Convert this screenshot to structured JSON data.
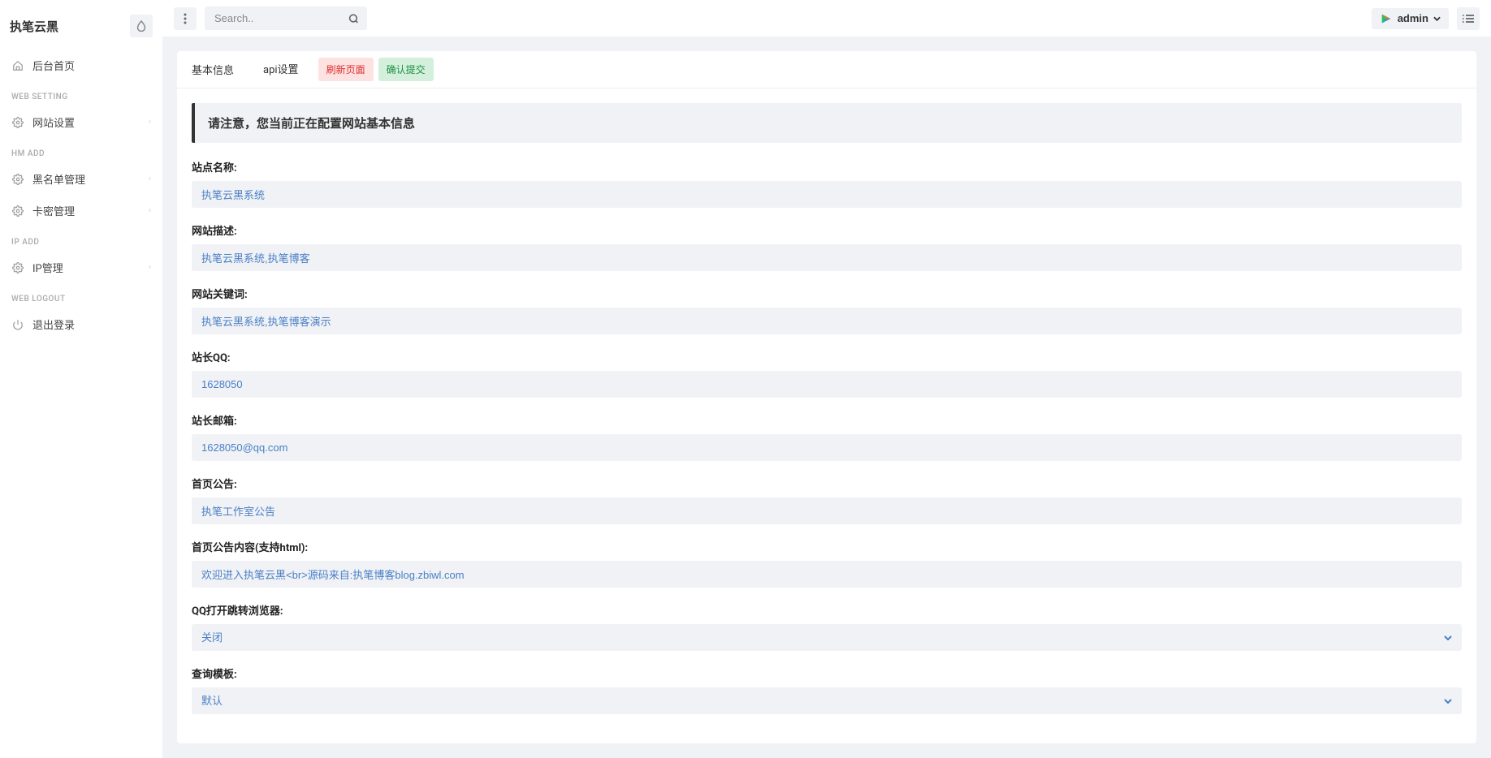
{
  "app": {
    "title": "执笔云黑"
  },
  "search": {
    "placeholder": "Search.."
  },
  "user": {
    "name": "admin"
  },
  "sidebar": {
    "home": {
      "label": "后台首页"
    },
    "sections": [
      {
        "header": "WEB SETTING",
        "items": [
          {
            "label": "网站设置",
            "icon": "gear",
            "expandable": true
          }
        ]
      },
      {
        "header": "HM ADD",
        "items": [
          {
            "label": "黑名单管理",
            "icon": "gear",
            "expandable": true
          },
          {
            "label": "卡密管理",
            "icon": "gear",
            "expandable": true
          }
        ]
      },
      {
        "header": "IP ADD",
        "items": [
          {
            "label": "IP管理",
            "icon": "gear",
            "expandable": true
          }
        ]
      },
      {
        "header": "WEB LOGOUT",
        "items": [
          {
            "label": "退出登录",
            "icon": "power",
            "expandable": false
          }
        ]
      }
    ]
  },
  "tabs": {
    "items": [
      {
        "label": "基本信息",
        "active": true
      },
      {
        "label": "api设置",
        "active": false
      }
    ],
    "refresh": "刷新页面",
    "submit": "确认提交"
  },
  "alert": "请注意，您当前正在配置网站基本信息",
  "form": {
    "site_name": {
      "label": "站点名称:",
      "value": "执笔云黑系统"
    },
    "site_desc": {
      "label": "网站描述:",
      "value": "执笔云黑系统,执笔博客"
    },
    "site_keywords": {
      "label": "网站关键词:",
      "value": "执笔云黑系统,执笔博客演示"
    },
    "admin_qq": {
      "label": "站长QQ:",
      "value": "1628050"
    },
    "admin_email": {
      "label": "站长邮箱:",
      "value": "1628050@qq.com"
    },
    "home_notice": {
      "label": "首页公告:",
      "value": "执笔工作室公告"
    },
    "home_notice_content": {
      "label": "首页公告内容(支持html):",
      "value": "欢迎进入执笔云黑<br>源码来自:执笔博客blog.zbiwl.com"
    },
    "qq_jump": {
      "label": "QQ打开跳转浏览器:",
      "value": "关闭"
    },
    "query_template": {
      "label": "查询模板:",
      "value": "默认"
    }
  }
}
